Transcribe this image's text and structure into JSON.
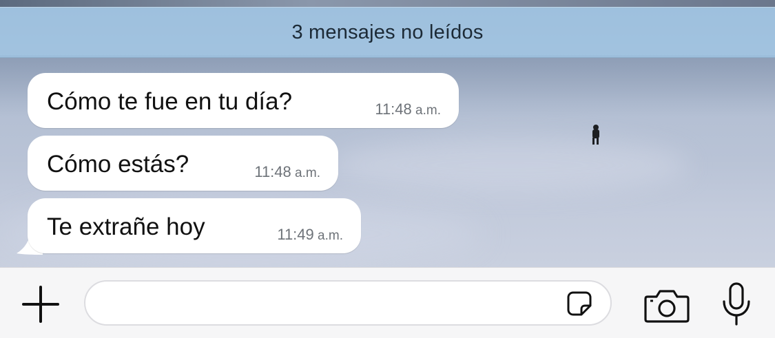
{
  "unread_banner": {
    "text": "3 mensajes no leídos"
  },
  "messages": [
    {
      "text": "Cómo te fue en tu día?",
      "time": "11:48",
      "ampm": "a.m."
    },
    {
      "text": "Cómo estás?",
      "time": "11:48",
      "ampm": "a.m."
    },
    {
      "text": "Te extrañe hoy",
      "time": "11:49",
      "ampm": "a.m."
    }
  ],
  "composer": {
    "input_value": "",
    "input_placeholder": "",
    "icons": [
      "plus-icon",
      "sticker-icon",
      "camera-icon",
      "microphone-icon"
    ]
  },
  "colors": {
    "banner": "#a0c6e4",
    "bubble": "#ffffff",
    "composer_bg": "#f6f6f7",
    "timestamp": "#6d7278"
  }
}
